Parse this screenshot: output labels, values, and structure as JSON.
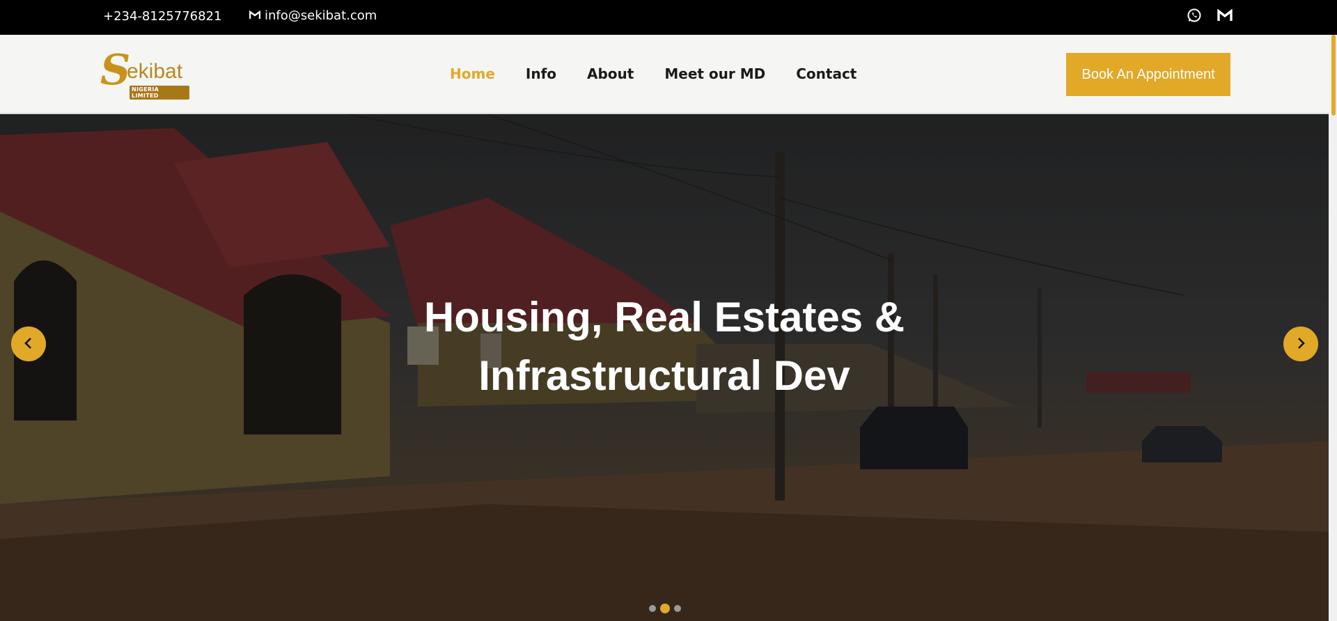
{
  "topbar": {
    "phone": "+234-8125776821",
    "email": "info@sekibat.com",
    "email_icon": "gmail-icon",
    "social_icons": [
      "whatsapp-icon",
      "gmail-icon"
    ]
  },
  "header": {
    "logo": {
      "main": "ekibat",
      "initial": "S",
      "tagline": "NIGERIA LIMITED"
    },
    "nav": [
      {
        "label": "Home",
        "active": true
      },
      {
        "label": "Info",
        "active": false
      },
      {
        "label": "About",
        "active": false
      },
      {
        "label": "Meet our MD",
        "active": false
      },
      {
        "label": "Contact",
        "active": false
      }
    ],
    "cta_label": "Book An Appointment"
  },
  "hero": {
    "title_line1": "Housing, Real Estates &",
    "title_line2": "Infrastructural Dev",
    "prev_icon": "chevron-left-icon",
    "next_icon": "chevron-right-icon",
    "slide_count": 3,
    "active_slide": 2
  },
  "colors": {
    "accent": "#e2a928",
    "topbar_bg": "#000000",
    "header_bg": "#f5f6f4",
    "nav_text": "#1a1a1a"
  }
}
